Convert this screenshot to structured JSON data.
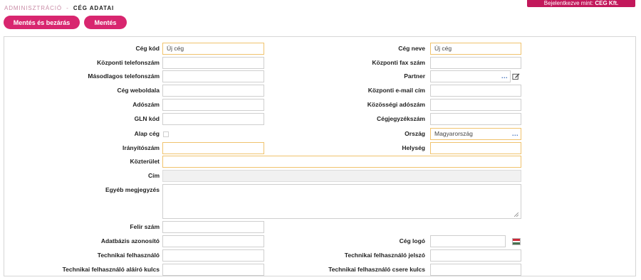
{
  "header": {
    "login_text": "Bejelentkezve mint:",
    "login_user": "CEG Kft.",
    "breadcrumb_parent": "ADMINISZTRÁCIÓ",
    "breadcrumb_sep": "-",
    "breadcrumb_current": "CÉG ADATAI"
  },
  "toolbar": {
    "save_close_label": "Mentés és bezárás",
    "save_label": "Mentés"
  },
  "colors": {
    "accent": "#d8266f",
    "badge": "#c2185b",
    "required_border": "#f0c36d"
  },
  "form": {
    "ceg_kod": {
      "label": "Cég kód",
      "value": "Új cég"
    },
    "ceg_neve": {
      "label": "Cég neve",
      "value": "Új cég"
    },
    "kozponti_telefonszam": {
      "label": "Központi telefonszám",
      "value": ""
    },
    "kozponti_fax": {
      "label": "Központi fax szám",
      "value": ""
    },
    "masodlagos_telefonszam": {
      "label": "Másodlagos telefonszám",
      "value": ""
    },
    "partner": {
      "label": "Partner",
      "value": "",
      "lookup": "...",
      "edit_icon": "edit-icon"
    },
    "ceg_weboldala": {
      "label": "Cég weboldala",
      "value": ""
    },
    "kozponti_email": {
      "label": "Központi e-mail cím",
      "value": ""
    },
    "adoszam": {
      "label": "Adószám",
      "value": ""
    },
    "kozossegi_adoszam": {
      "label": "Közösségi adószám",
      "value": ""
    },
    "gln_kod": {
      "label": "GLN kód",
      "value": ""
    },
    "cegjegyzekszam": {
      "label": "Cégjegyzékszám",
      "value": ""
    },
    "alap_ceg": {
      "label": "Alap cég",
      "checked": false
    },
    "orszag": {
      "label": "Ország",
      "value": "Magyarország",
      "lookup": "..."
    },
    "iranyitoszam": {
      "label": "Irányítószám",
      "value": ""
    },
    "helyseg": {
      "label": "Helység",
      "value": ""
    },
    "kozterulet": {
      "label": "Közterület",
      "value": ""
    },
    "cim": {
      "label": "Cím",
      "value": ""
    },
    "egyeb_megjegyzes": {
      "label": "Egyéb megjegyzés",
      "value": ""
    },
    "felir_szam": {
      "label": "Felir szám",
      "value": ""
    },
    "adatbazis_azonosito": {
      "label": "Adatbázis azonosító",
      "value": ""
    },
    "ceg_logo": {
      "label": "Cég logó",
      "value": "",
      "icon": "flag-icon"
    },
    "technikai_felhasznalo": {
      "label": "Technikai felhasználó",
      "value": ""
    },
    "technikai_jelszo": {
      "label": "Technikai felhasználó jelszó",
      "value": ""
    },
    "technikai_alairo_kulcs": {
      "label": "Technikai felhasználó aláíró kulcs",
      "value": ""
    },
    "technikai_csere_kulcs": {
      "label": "Technikai felhasználó csere kulcs",
      "value": ""
    }
  }
}
